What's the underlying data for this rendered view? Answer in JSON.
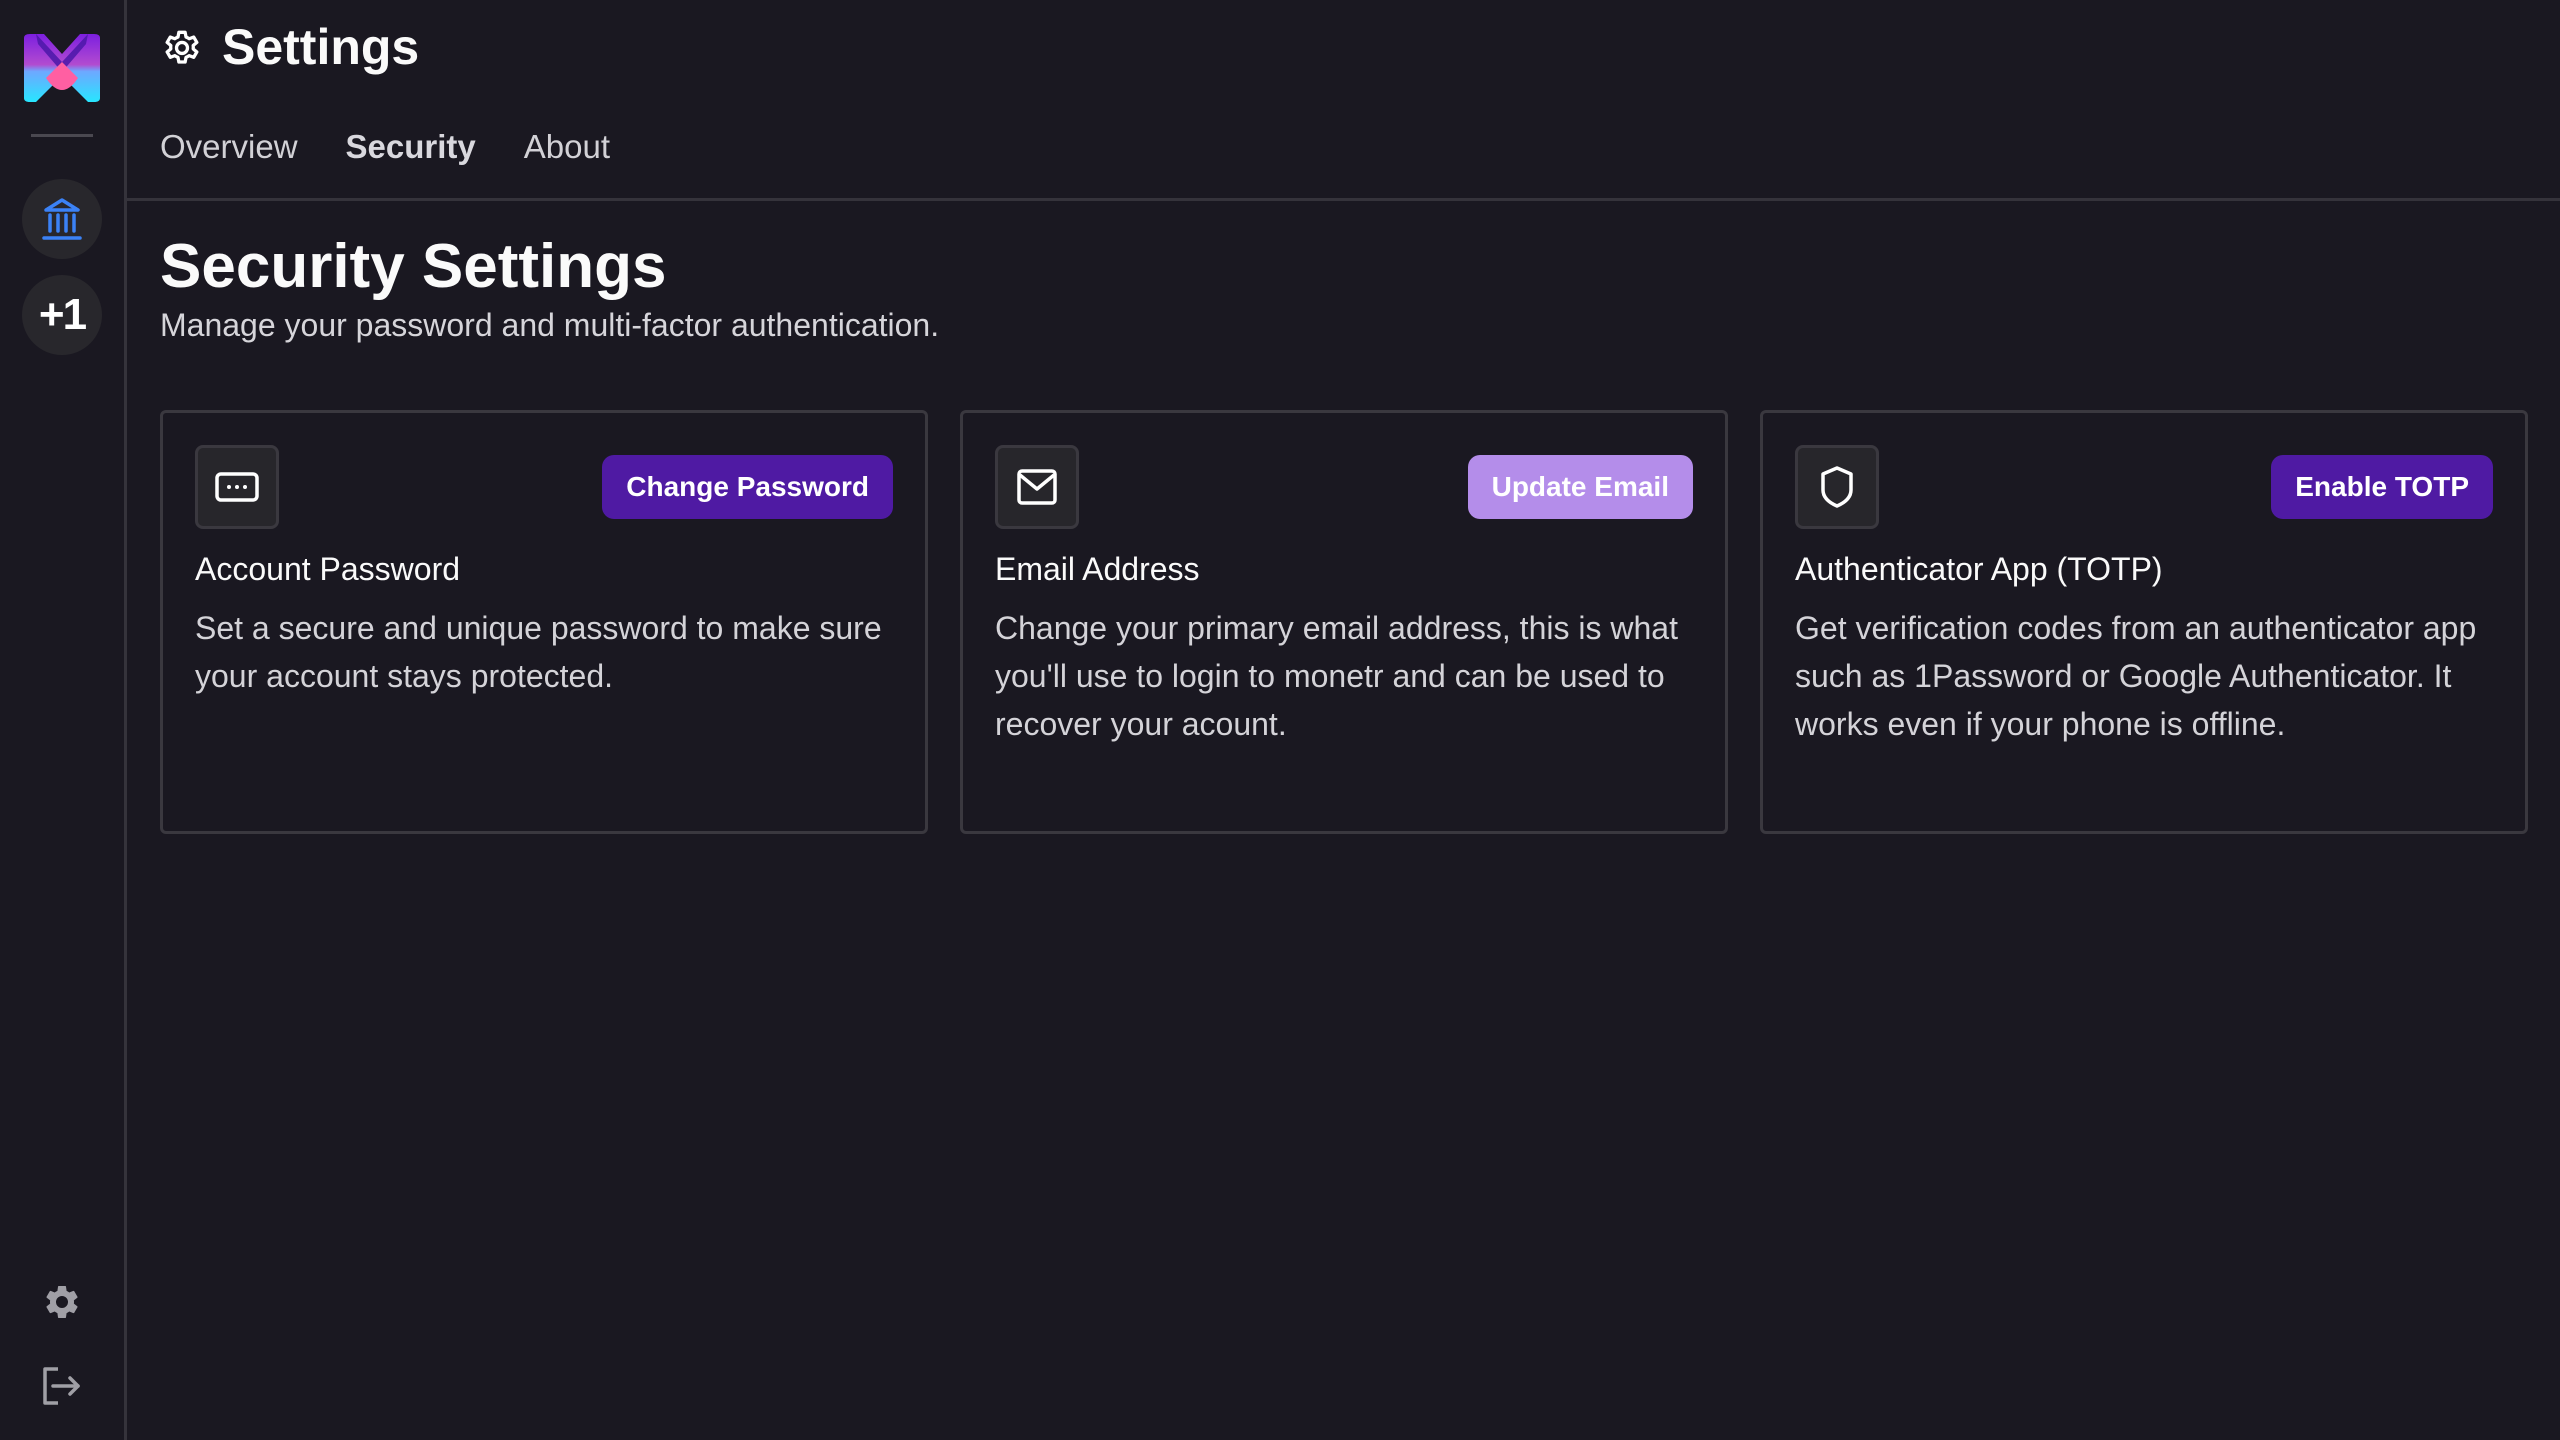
{
  "app": {
    "name": "monetr"
  },
  "sidebar": {
    "items": [
      {
        "name": "bank-account",
        "icon": "bank-icon",
        "label": ""
      },
      {
        "name": "add-link",
        "label": "+1"
      }
    ],
    "bottom": [
      {
        "name": "settings",
        "icon": "gear-icon"
      },
      {
        "name": "logout",
        "icon": "logout-icon"
      }
    ]
  },
  "header": {
    "title": "Settings",
    "icon": "gear-icon",
    "tabs": [
      {
        "label": "Overview",
        "active": false
      },
      {
        "label": "Security",
        "active": true
      },
      {
        "label": "About",
        "active": false
      }
    ]
  },
  "page": {
    "title": "Security Settings",
    "subtitle": "Manage your password and multi-factor authentication."
  },
  "cards": [
    {
      "icon": "password-icon",
      "button": "Change Password",
      "title": "Account Password",
      "description": "Set a secure and unique password to make sure your account stays protected."
    },
    {
      "icon": "mail-icon",
      "button": "Update Email",
      "title": "Email Address",
      "description": "Change your primary email address, this is what you'll use to login to monetr and can be used to recover your acount."
    },
    {
      "icon": "shield-icon",
      "button": "Enable TOTP",
      "title": "Authenticator App (TOTP)",
      "description": "Get verification codes from an authenticator app such as 1Password or Google Authenticator. It works even if your phone is offline."
    }
  ],
  "colors": {
    "background": "#1a1821",
    "primary_button": "#4f1aa3",
    "secondary_button": "#b48dea",
    "bank_icon": "#3b82f6",
    "border": "#3a383f"
  }
}
